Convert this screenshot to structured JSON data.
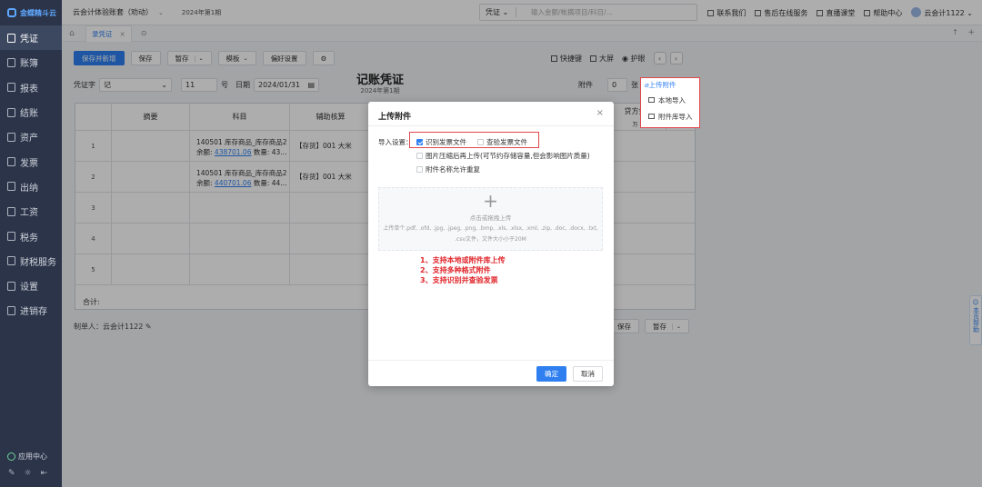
{
  "sidebar": {
    "logo": "金蝶精斗云",
    "items": [
      {
        "label": "凭证",
        "icon": "voucher-icon",
        "active": true
      },
      {
        "label": "账簿",
        "icon": "ledger-icon"
      },
      {
        "label": "报表",
        "icon": "report-icon"
      },
      {
        "label": "结账",
        "icon": "close-books-icon"
      },
      {
        "label": "资产",
        "icon": "asset-icon"
      },
      {
        "label": "发票",
        "icon": "invoice-icon"
      },
      {
        "label": "出纳",
        "icon": "cashier-icon"
      },
      {
        "label": "工资",
        "icon": "salary-icon"
      },
      {
        "label": "税务",
        "icon": "tax-icon"
      },
      {
        "label": "财税服务",
        "icon": "service-icon"
      },
      {
        "label": "设置",
        "icon": "settings-icon"
      },
      {
        "label": "进销存",
        "icon": "inventory-icon"
      }
    ],
    "app_center": "应用中心"
  },
  "topbar": {
    "company": "云会计体验账套（劝动）",
    "period": "2024年第1期",
    "search_type": "凭证",
    "search_placeholder": "输入金额/帐摘项目/科目/...",
    "links": [
      "联系我们",
      "售后在线服务",
      "直播课堂",
      "帮助中心"
    ],
    "user": "云会计1122"
  },
  "tabs": {
    "active": "录凭证"
  },
  "toolbar": {
    "save_new": "保存并新增",
    "save": "保存",
    "draft": "暂存",
    "template": "模板",
    "preferences": "偏好设置",
    "quick_keys": "快捷键",
    "fullscreen": "大屏",
    "eye_care": "护眼"
  },
  "voucher": {
    "title": "记账凭证",
    "period": "2024年第1期",
    "word_label": "凭证字",
    "word": "记",
    "number": "11",
    "number_label": "号",
    "date_label": "日期",
    "date": "2024/01/31",
    "attach_label": "附件",
    "attach_count": "0",
    "attach_unit": "张",
    "headers": {
      "summary": "摘要",
      "subject": "科目",
      "aux": "辅助核算",
      "credit": "贷方金额",
      "credit_units": "万 千"
    },
    "rows": [
      {
        "num": "1",
        "subject": "140501 库存商品_库存商品2",
        "balance_label": "余额:",
        "balance": "438701.06",
        "qty": "数量: 43...",
        "aux": "【存货】001 大米"
      },
      {
        "num": "2",
        "subject": "140501 库存商品_库存商品2",
        "balance_label": "余额:",
        "balance": "440701.06",
        "qty": "数量: 44...",
        "aux": "【存货】001 大米"
      },
      {
        "num": "3"
      },
      {
        "num": "4"
      },
      {
        "num": "5"
      }
    ],
    "total_label": "合计:",
    "maker": "制单人：云会计1122"
  },
  "bottom": {
    "save": "保存",
    "draft": "暂存"
  },
  "help_tab": "本页帮助",
  "upload_menu": {
    "title": "上传附件",
    "local": "本地导入",
    "library": "附件库导入"
  },
  "dialog": {
    "title": "上传附件",
    "import_label": "导入设置：",
    "opt_recognize": "识别发票文件",
    "opt_verify": "查验发票文件",
    "opt_compress": "图片压缩后再上传(可节约存储容量,但会影响图片质量)",
    "opt_dup_names": "附件名称允许重复",
    "dz_title": "点击或拖拽上传",
    "dz_hint": "上传单个.pdf, .ofd, .jpg, .jpeg, .png, .bmp, .xls, .xlsx, .xml, .zip, .doc, .docx, .txt, .csv文件，文件大小小于20M",
    "features": [
      "1、支持本地或附件库上传",
      "2、支持多种格式附件",
      "3、支持识别并查验发票"
    ],
    "ok": "确定",
    "cancel": "取消"
  }
}
